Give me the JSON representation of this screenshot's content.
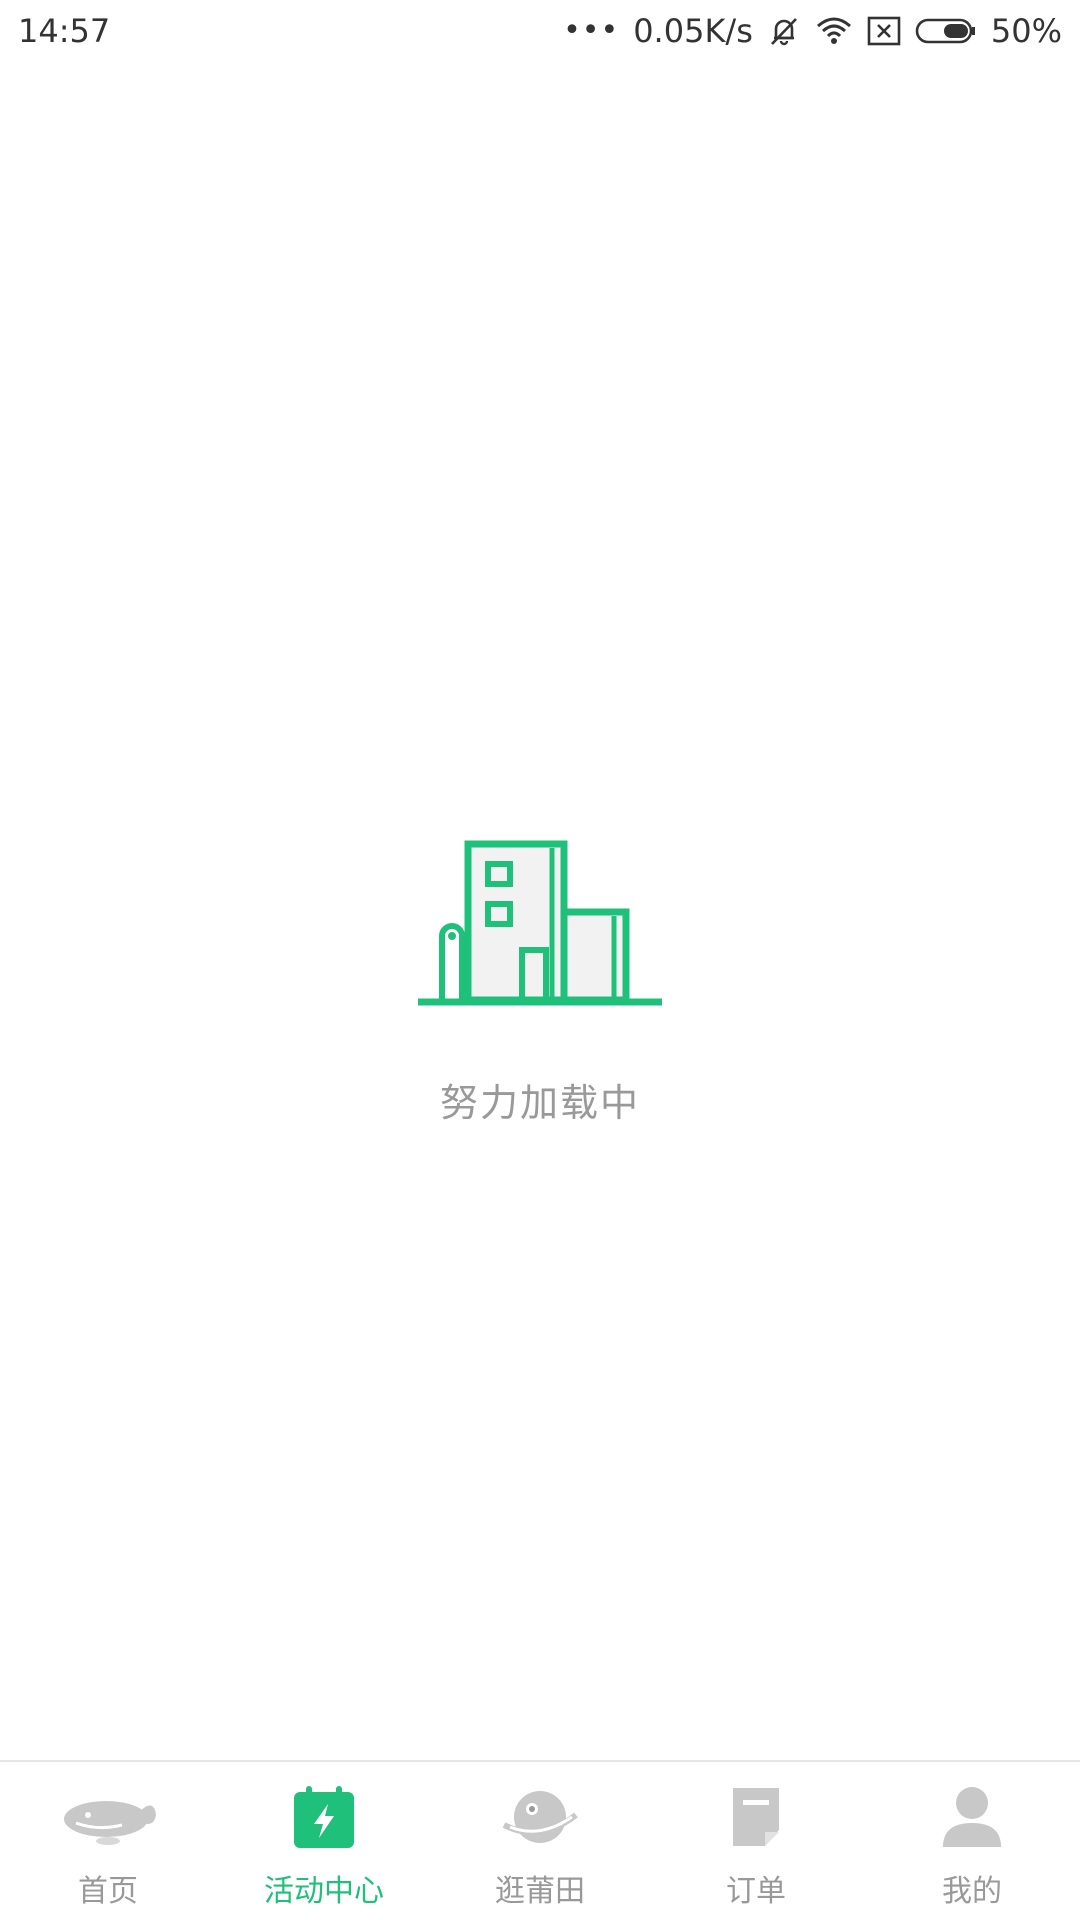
{
  "status_bar": {
    "time": "14:57",
    "dots": "•••",
    "network_speed": "0.05K/s",
    "battery_percent": "50%",
    "icons": [
      "mute-icon",
      "wifi-icon",
      "sim-card-x-icon",
      "battery-icon"
    ]
  },
  "loading": {
    "text": "努力加载中",
    "illustration": "building-icon",
    "accent_color": "#1fc07a"
  },
  "tab_bar": {
    "active_color": "#1fc07a",
    "inactive_color": "#bdbdbd",
    "tabs": [
      {
        "label": "首页",
        "icon": "whale-icon",
        "active": false
      },
      {
        "label": "活动中心",
        "icon": "calendar-bolt-icon",
        "active": true
      },
      {
        "label": "逛莆田",
        "icon": "planet-face-icon",
        "active": false
      },
      {
        "label": "订单",
        "icon": "document-icon",
        "active": false
      },
      {
        "label": "我的",
        "icon": "user-icon",
        "active": false
      }
    ]
  }
}
